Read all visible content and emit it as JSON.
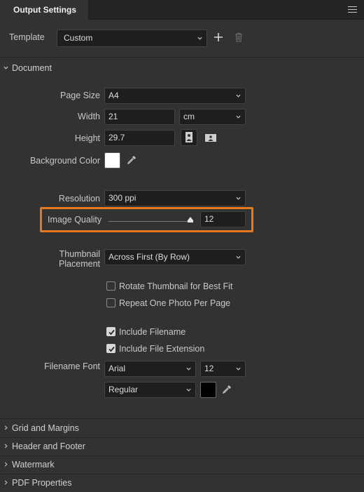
{
  "panel": {
    "tab_title": "Output Settings"
  },
  "template": {
    "label": "Template",
    "value": "Custom"
  },
  "document": {
    "title": "Document",
    "page_size": {
      "label": "Page Size",
      "value": "A4"
    },
    "width": {
      "label": "Width",
      "value": "21",
      "unit": "cm"
    },
    "height": {
      "label": "Height",
      "value": "29.7"
    },
    "background_color": {
      "label": "Background Color",
      "color": "#ffffff"
    },
    "resolution": {
      "label": "Resolution",
      "value": "300 ppi"
    },
    "image_quality": {
      "label": "Image Quality",
      "value": "12",
      "max": 12,
      "level": 1.0
    },
    "thumbnail_placement": {
      "label_line1": "Thumbnail",
      "label_line2": "Placement",
      "value": "Across First (By Row)"
    },
    "rotate_thumbnail": {
      "label": "Rotate Thumbnail for Best Fit",
      "checked": false
    },
    "repeat_photo": {
      "label": "Repeat One Photo Per Page",
      "checked": false
    },
    "include_filename": {
      "label": "Include Filename",
      "checked": true
    },
    "include_extension": {
      "label": "Include File Extension",
      "checked": true
    },
    "filename_font": {
      "label": "Filename Font",
      "family": "Arial",
      "size": "12",
      "style": "Regular",
      "color": "#000000"
    }
  },
  "sections": [
    {
      "title": "Grid and Margins"
    },
    {
      "title": "Header and Footer"
    },
    {
      "title": "Watermark"
    },
    {
      "title": "PDF Properties"
    }
  ],
  "colors": {
    "highlight": "#e8781d",
    "panel_bg": "#323232",
    "field_bg": "#1e1e1e"
  },
  "icons": [
    "menu-icon",
    "plus-icon",
    "trash-icon",
    "chevron-down-icon",
    "portrait-icon",
    "landscape-icon",
    "eyedropper-icon",
    "chevron-right-icon"
  ]
}
